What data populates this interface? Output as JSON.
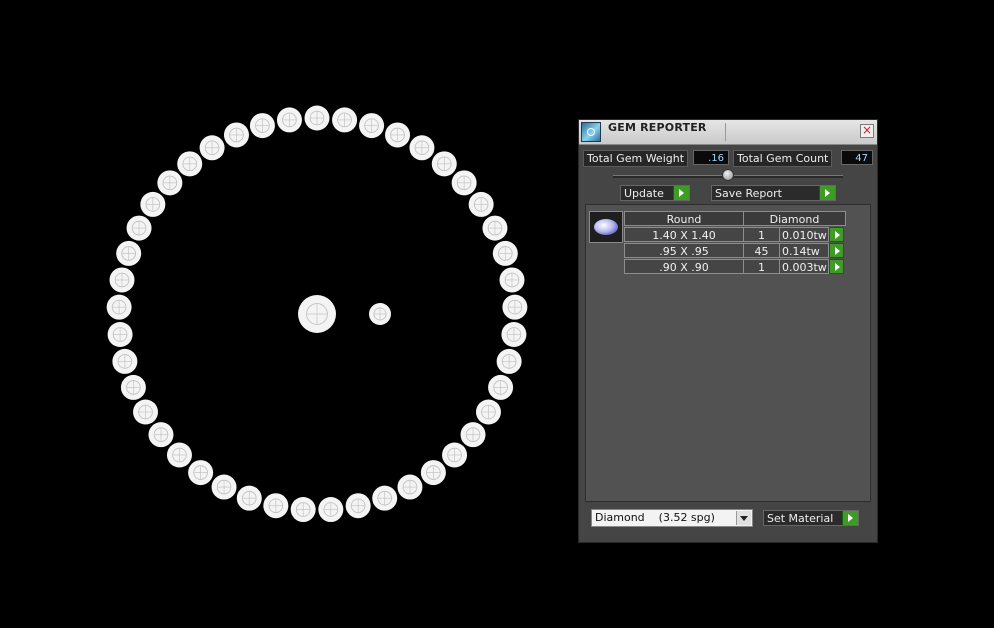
{
  "panel": {
    "title": "GEM REPORTER",
    "total_weight_label": "Total Gem Weight",
    "total_weight_value": ".16",
    "total_count_label": "Total Gem Count",
    "total_count_value": "47",
    "update_label": "Update",
    "save_report_label": "Save Report",
    "table": {
      "headers": [
        "Round",
        "Diamond"
      ],
      "rows": [
        {
          "size": "1.40 X 1.40",
          "count": "1",
          "weight": "0.010tw"
        },
        {
          "size": ".95 X .95",
          "count": "45",
          "weight": "0.14tw"
        },
        {
          "size": ".90 X .90",
          "count": "1",
          "weight": "0.003tw"
        }
      ]
    },
    "material_select": "Diamond    (3.52 spg)",
    "set_material_label": "Set Material"
  },
  "colors": {
    "background": "#000000",
    "gem": "#ffffff",
    "panel": "#454545",
    "go_button": "#3e9b26"
  }
}
